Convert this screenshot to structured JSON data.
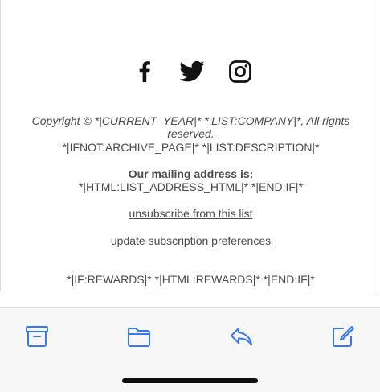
{
  "social": {
    "icons": [
      "facebook-icon",
      "twitter-icon",
      "instagram-icon"
    ]
  },
  "footer": {
    "copyright": "Copyright © *|CURRENT_YEAR|* *|LIST:COMPANY|*, All rights reserved.",
    "merge_line": "*|IFNOT:ARCHIVE_PAGE|* *|LIST:DESCRIPTION|*",
    "address_heading": "Our mailing address is:",
    "address_value": "*|HTML:LIST_ADDRESS_HTML|* *|END:IF|*",
    "unsubscribe_label": "unsubscribe from this list",
    "update_prefs_label": "update subscription preferences",
    "rewards_line": "*|IF:REWARDS|* *|HTML:REWARDS|* *|END:IF|*"
  },
  "toolbar": {
    "icons": [
      "archive-icon",
      "folder-icon",
      "reply-icon",
      "compose-icon"
    ],
    "accent": "#3478f6"
  }
}
